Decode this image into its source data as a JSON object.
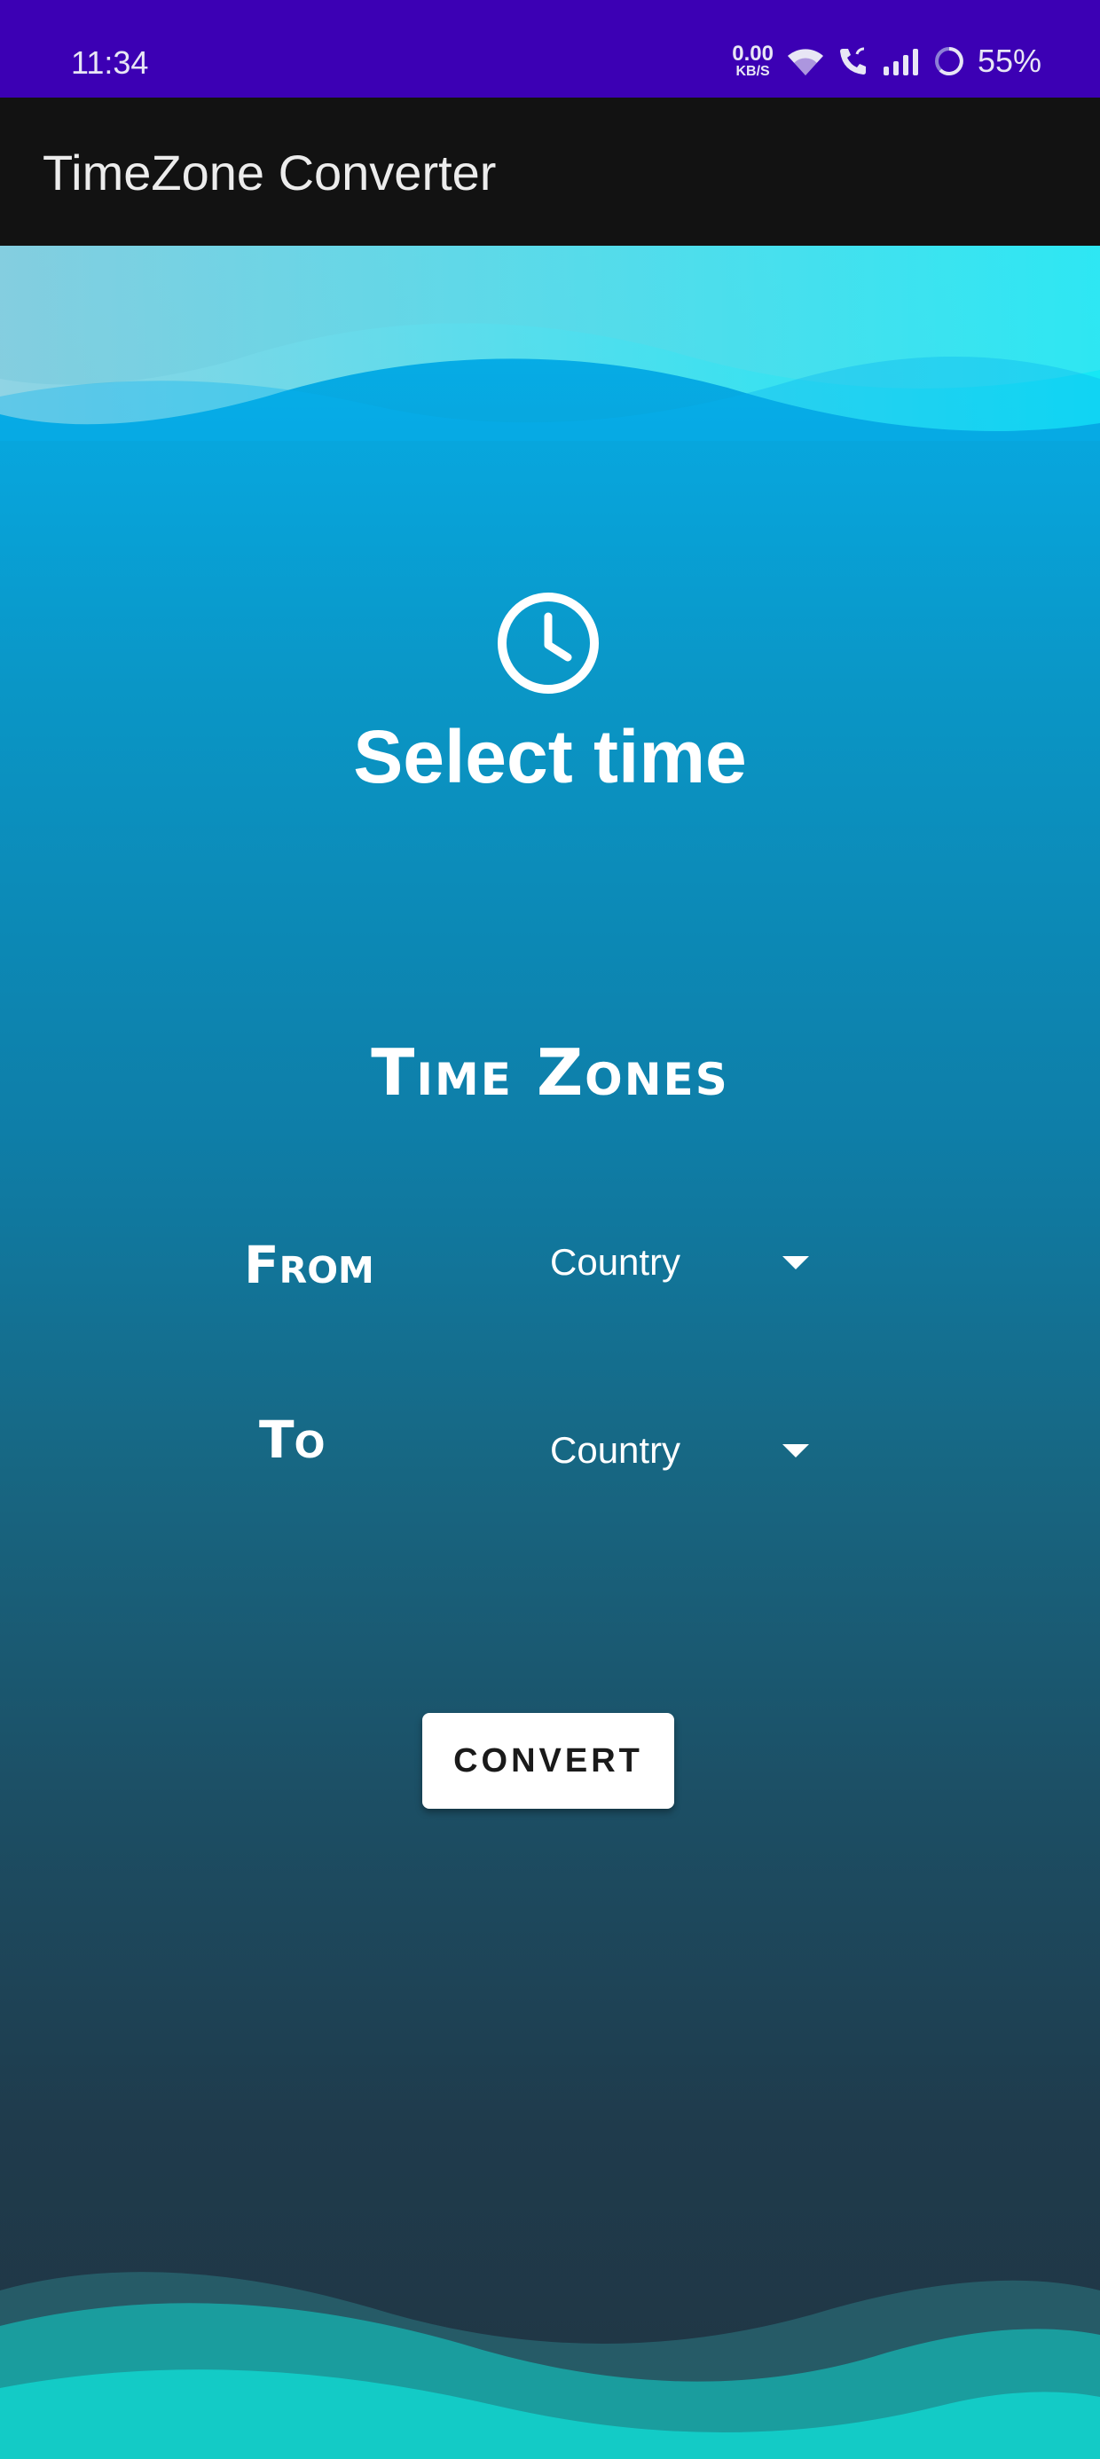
{
  "status_bar": {
    "time": "11:34",
    "net_speed_value": "0.00",
    "net_speed_unit": "KB/S",
    "battery_percent": "55%",
    "icons": [
      "wifi-icon",
      "wifi-call-icon",
      "signal-icon",
      "battery-icon"
    ]
  },
  "app_bar": {
    "title": "TimeZone Converter"
  },
  "main": {
    "clock_icon": "clock-icon",
    "select_time_label": "Select time",
    "timezones_title": "Time Zones",
    "from_label": "From",
    "to_label": "To",
    "from_dropdown": {
      "selected": "Country"
    },
    "to_dropdown": {
      "selected": "Country"
    },
    "convert_label": "CONVERT"
  },
  "colors": {
    "status_bar": "#3c00b4",
    "app_bar": "#121212",
    "gradient_top": "#05b3f0",
    "gradient_bottom": "#203543",
    "wave_top": "#2ee8f0",
    "wave_bottom": "#15c9c4"
  }
}
